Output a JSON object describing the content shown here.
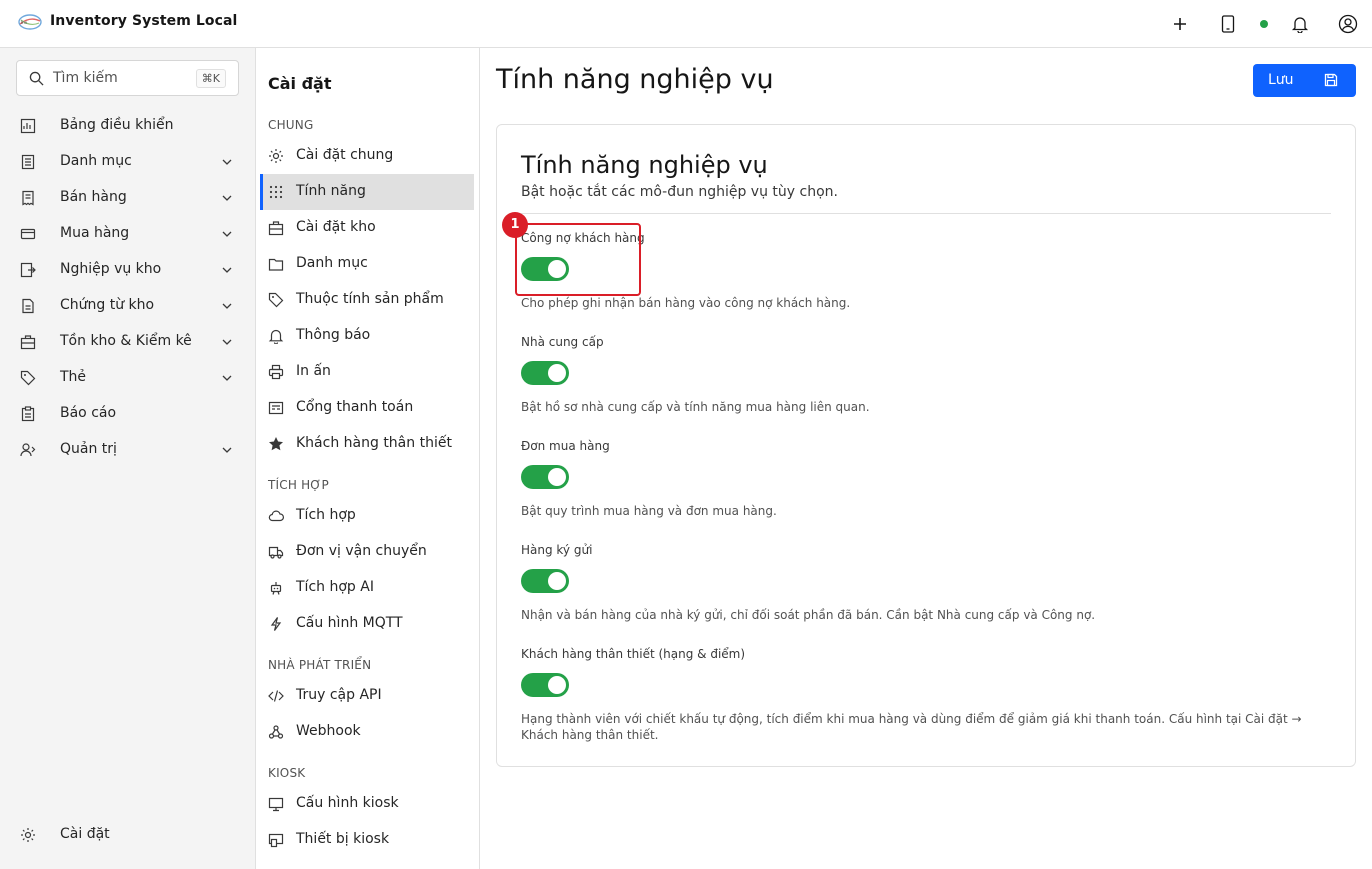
{
  "app": {
    "title": "Inventory System Local",
    "logo_icon": "brand-logo-icon",
    "header_actions": [
      "plus-icon",
      "tablet-icon",
      "status-dot",
      "bell-icon",
      "user-avatar-icon"
    ],
    "status_color": "#24a148",
    "accent_color": "#0f62fe"
  },
  "sidebar": {
    "search": {
      "placeholder": "Tìm kiếm",
      "shortcut": "⌘K"
    },
    "items": [
      {
        "label": "Bảng điều khiển",
        "icon": "dashboard-icon",
        "expandable": false
      },
      {
        "label": "Danh mục",
        "icon": "catalog-icon",
        "expandable": true
      },
      {
        "label": "Bán hàng",
        "icon": "receipt-icon",
        "expandable": true
      },
      {
        "label": "Mua hàng",
        "icon": "credit-card-icon",
        "expandable": true
      },
      {
        "label": "Nghiệp vụ kho",
        "icon": "warehouse-ops-icon",
        "expandable": true
      },
      {
        "label": "Chứng từ kho",
        "icon": "document-icon",
        "expandable": true
      },
      {
        "label": "Tồn kho & Kiểm kê",
        "icon": "inventory-icon",
        "expandable": true
      },
      {
        "label": "Thẻ",
        "icon": "tag-icon",
        "expandable": true
      },
      {
        "label": "Báo cáo",
        "icon": "report-icon",
        "expandable": false
      },
      {
        "label": "Quản trị",
        "icon": "admin-icon",
        "expandable": true
      }
    ],
    "footer": {
      "label": "Cài đặt",
      "icon": "gear-icon"
    }
  },
  "settings_nav": {
    "title": "Cài đặt",
    "groups": [
      {
        "label": "CHUNG",
        "items": [
          {
            "label": "Cài đặt chung",
            "icon": "gear-icon",
            "active": false
          },
          {
            "label": "Tính năng",
            "icon": "grid-dots-icon",
            "active": true
          },
          {
            "label": "Cài đặt kho",
            "icon": "warehouse-icon",
            "active": false
          },
          {
            "label": "Danh mục",
            "icon": "folder-icon",
            "active": false
          },
          {
            "label": "Thuộc tính sản phẩm",
            "icon": "tag-icon",
            "active": false
          },
          {
            "label": "Thông báo",
            "icon": "bell-icon",
            "active": false
          },
          {
            "label": "In ấn",
            "icon": "printer-icon",
            "active": false
          },
          {
            "label": "Cổng thanh toán",
            "icon": "payment-gateway-icon",
            "active": false
          },
          {
            "label": "Khách hàng thân thiết",
            "icon": "star-icon",
            "active": false
          }
        ]
      },
      {
        "label": "TÍCH HỢP",
        "items": [
          {
            "label": "Tích hợp",
            "icon": "cloud-icon",
            "active": false
          },
          {
            "label": "Đơn vị vận chuyển",
            "icon": "truck-icon",
            "active": false
          },
          {
            "label": "Tích hợp AI",
            "icon": "robot-icon",
            "active": false
          },
          {
            "label": "Cấu hình MQTT",
            "icon": "lightning-icon",
            "active": false
          }
        ]
      },
      {
        "label": "NHÀ PHÁT TRIỂN",
        "items": [
          {
            "label": "Truy cập API",
            "icon": "code-icon",
            "active": false
          },
          {
            "label": "Webhook",
            "icon": "webhook-icon",
            "active": false
          }
        ]
      },
      {
        "label": "KIOSK",
        "items": [
          {
            "label": "Cấu hình kiosk",
            "icon": "monitor-icon",
            "active": false
          },
          {
            "label": "Thiết bị kiosk",
            "icon": "kiosk-device-icon",
            "active": false
          }
        ]
      }
    ]
  },
  "main": {
    "page_title": "Tính năng nghiệp vụ",
    "save_label": "Lưu",
    "save_icon": "save-icon",
    "card": {
      "title": "Tính năng nghiệp vụ",
      "description": "Bật hoặc tắt các mô-đun nghiệp vụ tùy chọn.",
      "features": [
        {
          "label": "Công nợ khách hàng",
          "enabled": true,
          "help": "Cho phép ghi nhận bán hàng vào công nợ khách hàng."
        },
        {
          "label": "Nhà cung cấp",
          "enabled": true,
          "help": "Bật hồ sơ nhà cung cấp và tính năng mua hàng liên quan."
        },
        {
          "label": "Đơn mua hàng",
          "enabled": true,
          "help": "Bật quy trình mua hàng và đơn mua hàng."
        },
        {
          "label": "Hàng ký gửi",
          "enabled": true,
          "help": "Nhận và bán hàng của nhà ký gửi, chỉ đối soát phần đã bán. Cần bật Nhà cung cấp và Công nợ."
        },
        {
          "label": "Khách hàng thân thiết (hạng & điểm)",
          "enabled": true,
          "help": "Hạng thành viên với chiết khấu tự động, tích điểm khi mua hàng và dùng điểm để giảm giá khi thanh toán. Cấu hình tại Cài đặt → Khách hàng thân thiết."
        }
      ]
    },
    "annotation": {
      "marker": "1",
      "color": "#da1e28"
    }
  }
}
